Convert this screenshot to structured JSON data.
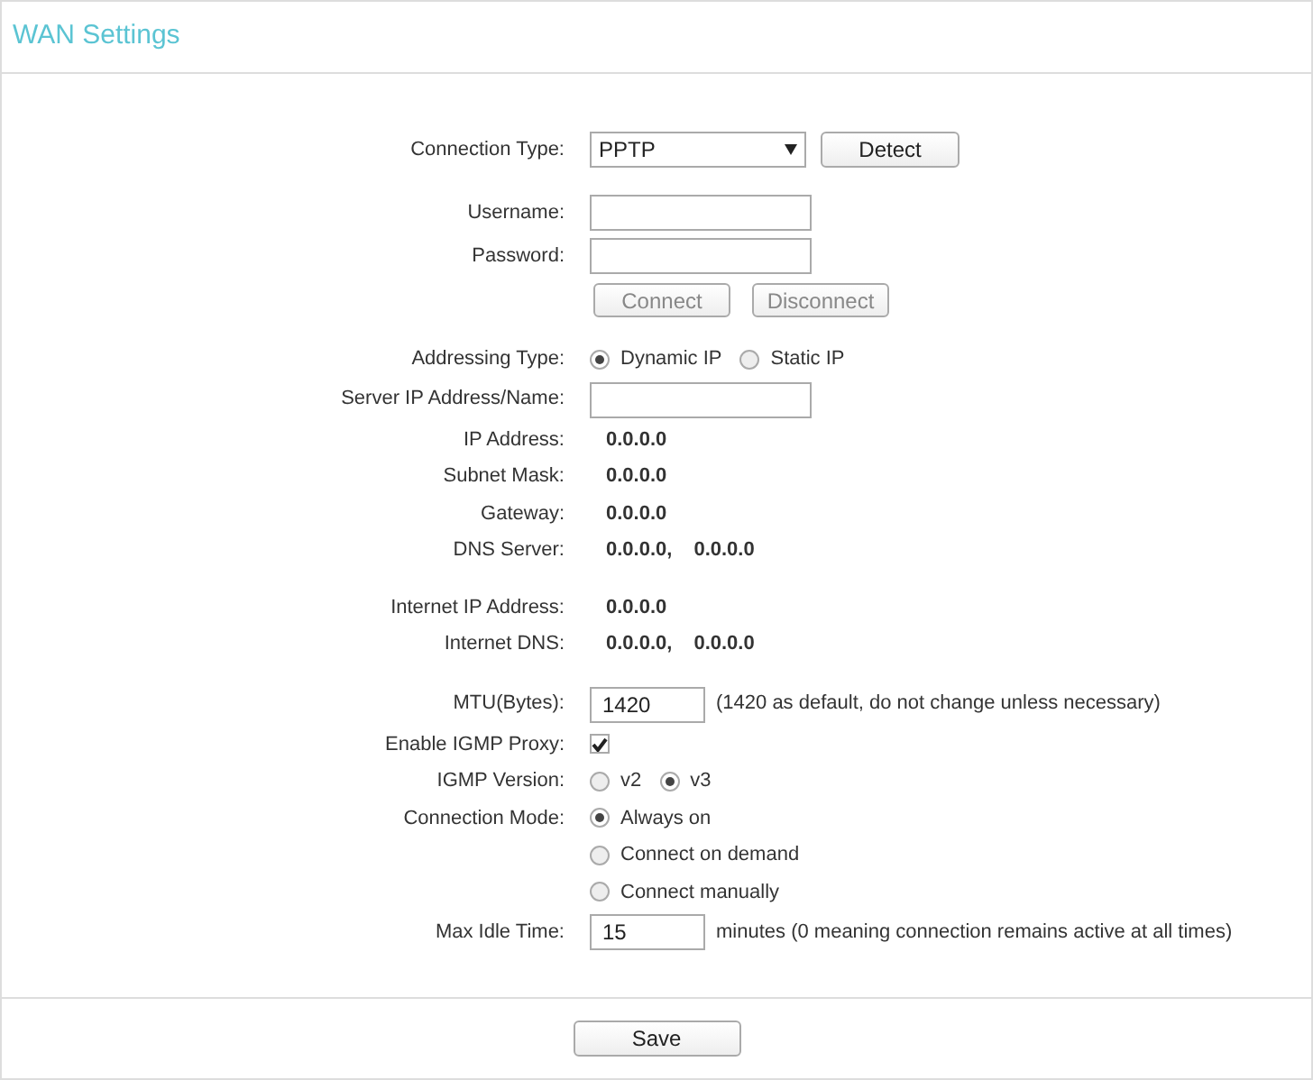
{
  "title": "WAN Settings",
  "sections": [
    {
      "rows": [
        {
          "kind": "select",
          "label": "Connection Type:",
          "value": "PPTP",
          "button": "Detect"
        }
      ]
    },
    {
      "rows": [
        {
          "kind": "input",
          "label": "Username:"
        },
        {
          "kind": "input",
          "label": "Password:"
        },
        {
          "kind": "buttons",
          "buttons": [
            {
              "label": "Connect",
              "disabled": true
            },
            {
              "label": "Disconnect",
              "disabled": true
            }
          ]
        }
      ]
    },
    {
      "rows": [
        {
          "kind": "radio",
          "label": "Addressing Type:",
          "options": [
            {
              "label": "Dynamic IP",
              "selected": true
            },
            {
              "label": "Static IP",
              "selected": false
            }
          ]
        },
        {
          "kind": "input",
          "label": "Server IP Address/Name:"
        },
        {
          "kind": "text",
          "label": "IP Address:",
          "values": [
            "0.0.0.0"
          ]
        },
        {
          "kind": "text",
          "label": "Subnet Mask:",
          "values": [
            "0.0.0.0"
          ]
        },
        {
          "kind": "text",
          "label": "Gateway:",
          "values": [
            "0.0.0.0"
          ]
        },
        {
          "kind": "text",
          "label": "DNS Server:",
          "values": [
            "0.0.0.0,",
            "0.0.0.0"
          ]
        }
      ]
    },
    {
      "rows": [
        {
          "kind": "text",
          "label": "Internet IP Address:",
          "values": [
            "0.0.0.0"
          ]
        },
        {
          "kind": "text",
          "label": "Internet DNS:",
          "values": [
            "0.0.0.0,",
            "0.0.0.0"
          ]
        }
      ]
    },
    {
      "rows": [
        {
          "kind": "input",
          "label": "MTU(Bytes):",
          "value": "1420",
          "note": "(1420 as default, do not change unless necessary)"
        },
        {
          "kind": "checkbox",
          "label": "Enable IGMP Proxy:",
          "checked": true
        },
        {
          "kind": "radio",
          "label": "IGMP Version:",
          "options": [
            {
              "label": "v2",
              "selected": false
            },
            {
              "label": "v3",
              "selected": true
            }
          ]
        },
        {
          "kind": "radio_stack",
          "label": "Connection Mode:",
          "options": [
            {
              "label": "Always on",
              "selected": true
            },
            {
              "label": "Connect on demand",
              "selected": false
            },
            {
              "label": "Connect manually",
              "selected": false
            }
          ]
        },
        {
          "kind": "input",
          "label": "Max Idle Time:",
          "value": "15",
          "note": "minutes (0 meaning connection remains active at all times)"
        }
      ]
    }
  ],
  "save": "Save"
}
